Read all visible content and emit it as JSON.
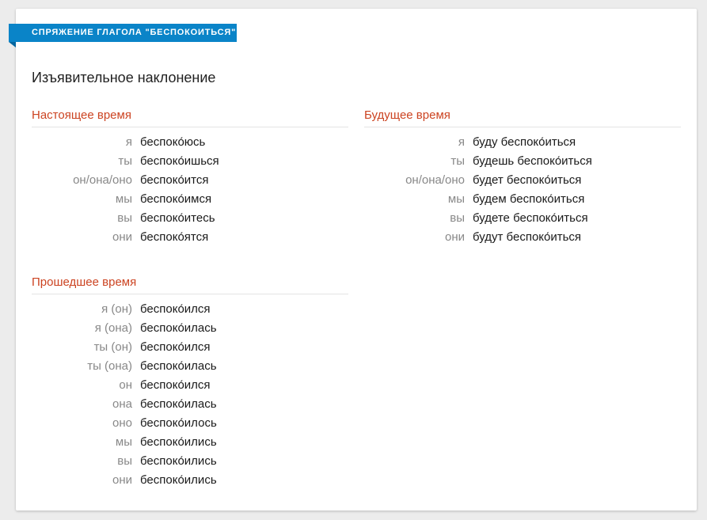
{
  "ribbon": {
    "label": "Спряжение глагола \"беспокоиться\""
  },
  "mood": {
    "title": "Изъявительное наклонение"
  },
  "present": {
    "title": "Настоящее время",
    "rows": [
      {
        "pronoun": "я",
        "form": "беспоко́юсь"
      },
      {
        "pronoun": "ты",
        "form": "беспоко́ишься"
      },
      {
        "pronoun": "он/она/оно",
        "form": "беспоко́ится"
      },
      {
        "pronoun": "мы",
        "form": "беспоко́имся"
      },
      {
        "pronoun": "вы",
        "form": "беспоко́итесь"
      },
      {
        "pronoun": "они",
        "form": "беспоко́ятся"
      }
    ]
  },
  "future": {
    "title": "Будущее время",
    "rows": [
      {
        "pronoun": "я",
        "form": "буду беспоко́иться"
      },
      {
        "pronoun": "ты",
        "form": "будешь беспоко́иться"
      },
      {
        "pronoun": "он/она/оно",
        "form": "будет беспоко́иться"
      },
      {
        "pronoun": "мы",
        "form": "будем беспоко́иться"
      },
      {
        "pronoun": "вы",
        "form": "будете беспоко́иться"
      },
      {
        "pronoun": "они",
        "form": "будут беспоко́иться"
      }
    ]
  },
  "past": {
    "title": "Прошедшее время",
    "rows": [
      {
        "pronoun": "я (он)",
        "form": "беспоко́ился"
      },
      {
        "pronoun": "я (она)",
        "form": "беспоко́илась"
      },
      {
        "pronoun": "ты (он)",
        "form": "беспоко́ился"
      },
      {
        "pronoun": "ты (она)",
        "form": "беспоко́илась"
      },
      {
        "pronoun": "он",
        "form": "беспоко́ился"
      },
      {
        "pronoun": "она",
        "form": "беспоко́илась"
      },
      {
        "pronoun": "оно",
        "form": "беспоко́илось"
      },
      {
        "pronoun": "мы",
        "form": "беспоко́ились"
      },
      {
        "pronoun": "вы",
        "form": "беспоко́ились"
      },
      {
        "pronoun": "они",
        "form": "беспоко́ились"
      }
    ]
  }
}
